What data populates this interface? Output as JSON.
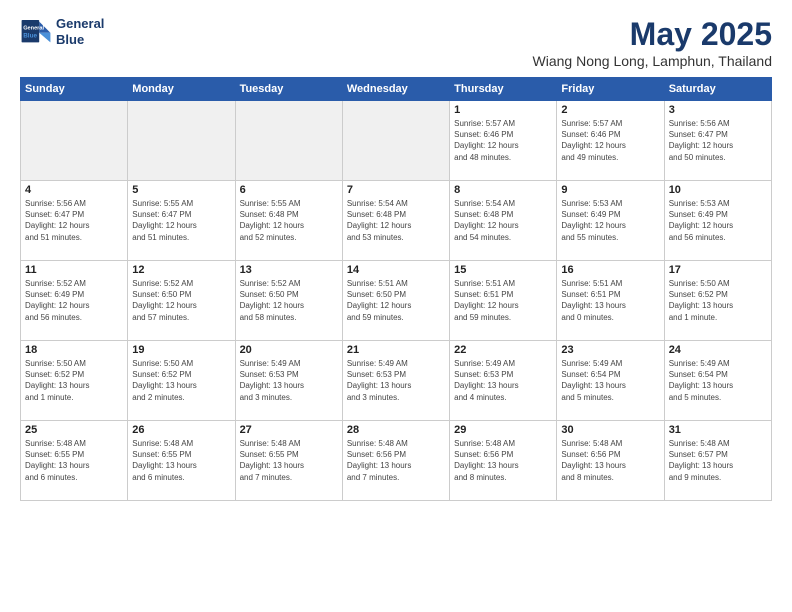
{
  "logo": {
    "line1": "General",
    "line2": "Blue"
  },
  "title": "May 2025",
  "location": "Wiang Nong Long, Lamphun, Thailand",
  "headers": [
    "Sunday",
    "Monday",
    "Tuesday",
    "Wednesday",
    "Thursday",
    "Friday",
    "Saturday"
  ],
  "weeks": [
    [
      {
        "day": "",
        "info": "",
        "shaded": true
      },
      {
        "day": "",
        "info": "",
        "shaded": true
      },
      {
        "day": "",
        "info": "",
        "shaded": true
      },
      {
        "day": "",
        "info": "",
        "shaded": true
      },
      {
        "day": "1",
        "info": "Sunrise: 5:57 AM\nSunset: 6:46 PM\nDaylight: 12 hours\nand 48 minutes."
      },
      {
        "day": "2",
        "info": "Sunrise: 5:57 AM\nSunset: 6:46 PM\nDaylight: 12 hours\nand 49 minutes."
      },
      {
        "day": "3",
        "info": "Sunrise: 5:56 AM\nSunset: 6:47 PM\nDaylight: 12 hours\nand 50 minutes."
      }
    ],
    [
      {
        "day": "4",
        "info": "Sunrise: 5:56 AM\nSunset: 6:47 PM\nDaylight: 12 hours\nand 51 minutes."
      },
      {
        "day": "5",
        "info": "Sunrise: 5:55 AM\nSunset: 6:47 PM\nDaylight: 12 hours\nand 51 minutes."
      },
      {
        "day": "6",
        "info": "Sunrise: 5:55 AM\nSunset: 6:48 PM\nDaylight: 12 hours\nand 52 minutes."
      },
      {
        "day": "7",
        "info": "Sunrise: 5:54 AM\nSunset: 6:48 PM\nDaylight: 12 hours\nand 53 minutes."
      },
      {
        "day": "8",
        "info": "Sunrise: 5:54 AM\nSunset: 6:48 PM\nDaylight: 12 hours\nand 54 minutes."
      },
      {
        "day": "9",
        "info": "Sunrise: 5:53 AM\nSunset: 6:49 PM\nDaylight: 12 hours\nand 55 minutes."
      },
      {
        "day": "10",
        "info": "Sunrise: 5:53 AM\nSunset: 6:49 PM\nDaylight: 12 hours\nand 56 minutes."
      }
    ],
    [
      {
        "day": "11",
        "info": "Sunrise: 5:52 AM\nSunset: 6:49 PM\nDaylight: 12 hours\nand 56 minutes."
      },
      {
        "day": "12",
        "info": "Sunrise: 5:52 AM\nSunset: 6:50 PM\nDaylight: 12 hours\nand 57 minutes."
      },
      {
        "day": "13",
        "info": "Sunrise: 5:52 AM\nSunset: 6:50 PM\nDaylight: 12 hours\nand 58 minutes."
      },
      {
        "day": "14",
        "info": "Sunrise: 5:51 AM\nSunset: 6:50 PM\nDaylight: 12 hours\nand 59 minutes."
      },
      {
        "day": "15",
        "info": "Sunrise: 5:51 AM\nSunset: 6:51 PM\nDaylight: 12 hours\nand 59 minutes."
      },
      {
        "day": "16",
        "info": "Sunrise: 5:51 AM\nSunset: 6:51 PM\nDaylight: 13 hours\nand 0 minutes."
      },
      {
        "day": "17",
        "info": "Sunrise: 5:50 AM\nSunset: 6:52 PM\nDaylight: 13 hours\nand 1 minute."
      }
    ],
    [
      {
        "day": "18",
        "info": "Sunrise: 5:50 AM\nSunset: 6:52 PM\nDaylight: 13 hours\nand 1 minute."
      },
      {
        "day": "19",
        "info": "Sunrise: 5:50 AM\nSunset: 6:52 PM\nDaylight: 13 hours\nand 2 minutes."
      },
      {
        "day": "20",
        "info": "Sunrise: 5:49 AM\nSunset: 6:53 PM\nDaylight: 13 hours\nand 3 minutes."
      },
      {
        "day": "21",
        "info": "Sunrise: 5:49 AM\nSunset: 6:53 PM\nDaylight: 13 hours\nand 3 minutes."
      },
      {
        "day": "22",
        "info": "Sunrise: 5:49 AM\nSunset: 6:53 PM\nDaylight: 13 hours\nand 4 minutes."
      },
      {
        "day": "23",
        "info": "Sunrise: 5:49 AM\nSunset: 6:54 PM\nDaylight: 13 hours\nand 5 minutes."
      },
      {
        "day": "24",
        "info": "Sunrise: 5:49 AM\nSunset: 6:54 PM\nDaylight: 13 hours\nand 5 minutes."
      }
    ],
    [
      {
        "day": "25",
        "info": "Sunrise: 5:48 AM\nSunset: 6:55 PM\nDaylight: 13 hours\nand 6 minutes."
      },
      {
        "day": "26",
        "info": "Sunrise: 5:48 AM\nSunset: 6:55 PM\nDaylight: 13 hours\nand 6 minutes."
      },
      {
        "day": "27",
        "info": "Sunrise: 5:48 AM\nSunset: 6:55 PM\nDaylight: 13 hours\nand 7 minutes."
      },
      {
        "day": "28",
        "info": "Sunrise: 5:48 AM\nSunset: 6:56 PM\nDaylight: 13 hours\nand 7 minutes."
      },
      {
        "day": "29",
        "info": "Sunrise: 5:48 AM\nSunset: 6:56 PM\nDaylight: 13 hours\nand 8 minutes."
      },
      {
        "day": "30",
        "info": "Sunrise: 5:48 AM\nSunset: 6:56 PM\nDaylight: 13 hours\nand 8 minutes."
      },
      {
        "day": "31",
        "info": "Sunrise: 5:48 AM\nSunset: 6:57 PM\nDaylight: 13 hours\nand 9 minutes."
      }
    ]
  ]
}
